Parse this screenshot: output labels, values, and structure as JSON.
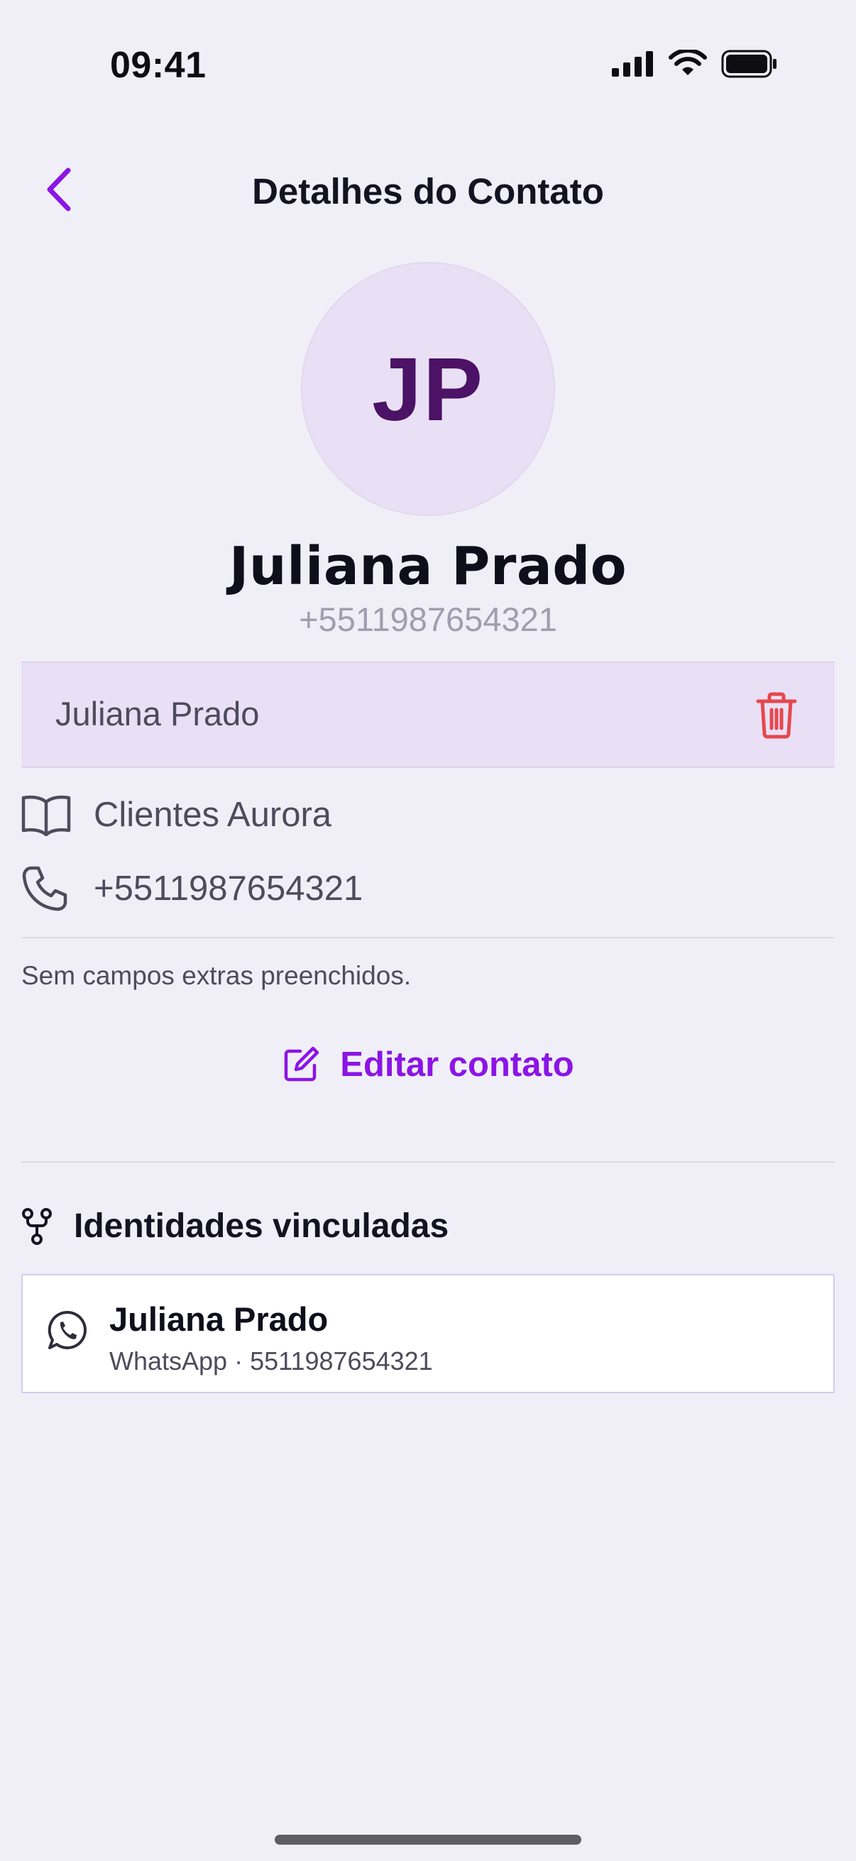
{
  "status_bar": {
    "time": "09:41"
  },
  "header": {
    "title": "Detalhes do Contato"
  },
  "contact": {
    "initials": "JP",
    "name": "Juliana Prado",
    "phone": "+5511987654321"
  },
  "name_row": {
    "label": "Juliana Prado"
  },
  "info": {
    "group": "Clientes Aurora",
    "phone": "+5511987654321"
  },
  "extras_note": "Sem campos extras preenchidos.",
  "edit_button": {
    "label": "Editar contato"
  },
  "linked": {
    "title": "Identidades vinculadas",
    "items": [
      {
        "name": "Juliana Prado",
        "meta": "WhatsApp · 5511987654321",
        "icon": "whatsapp-icon"
      }
    ]
  },
  "colors": {
    "accent": "#8b14e6",
    "danger": "#e5484d",
    "avatar_bg": "#e9e0f5",
    "avatar_text": "#4b1265",
    "background": "#f0eff7"
  }
}
